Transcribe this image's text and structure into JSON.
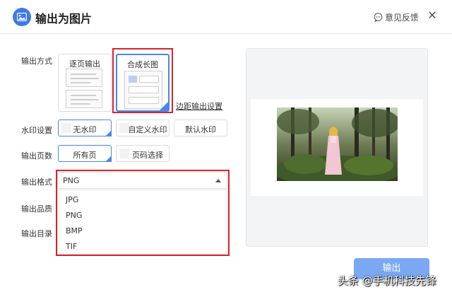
{
  "window": {
    "title": "输出为图片",
    "feedback_label": "意见反馈",
    "close_glyph": "✕"
  },
  "output_mode": {
    "label": "输出方式",
    "options": [
      {
        "label": "逐页输出",
        "selected": false
      },
      {
        "label": "合成长图",
        "selected": true
      }
    ],
    "margin_link": "边距输出设置"
  },
  "watermark": {
    "label": "水印设置",
    "options": [
      {
        "label": "无水印",
        "selected": true
      },
      {
        "label": "自定义水印",
        "selected": false
      },
      {
        "label": "默认水印",
        "selected": false
      }
    ]
  },
  "pages": {
    "label": "输出页数",
    "options": [
      {
        "label": "所有页",
        "selected": true
      },
      {
        "label": "页码选择",
        "selected": false
      }
    ]
  },
  "format": {
    "label": "输出格式",
    "value": "PNG",
    "options": [
      "JPG",
      "PNG",
      "BMP",
      "TIF"
    ]
  },
  "quality": {
    "label": "输出品质"
  },
  "directory": {
    "label": "输出目录"
  },
  "export_button": "输出",
  "overlay_watermark": "头条 @手机科技先锋",
  "colors": {
    "accent": "#4a86e8",
    "highlight": "#d9232b",
    "button": "#7aa8f2"
  }
}
